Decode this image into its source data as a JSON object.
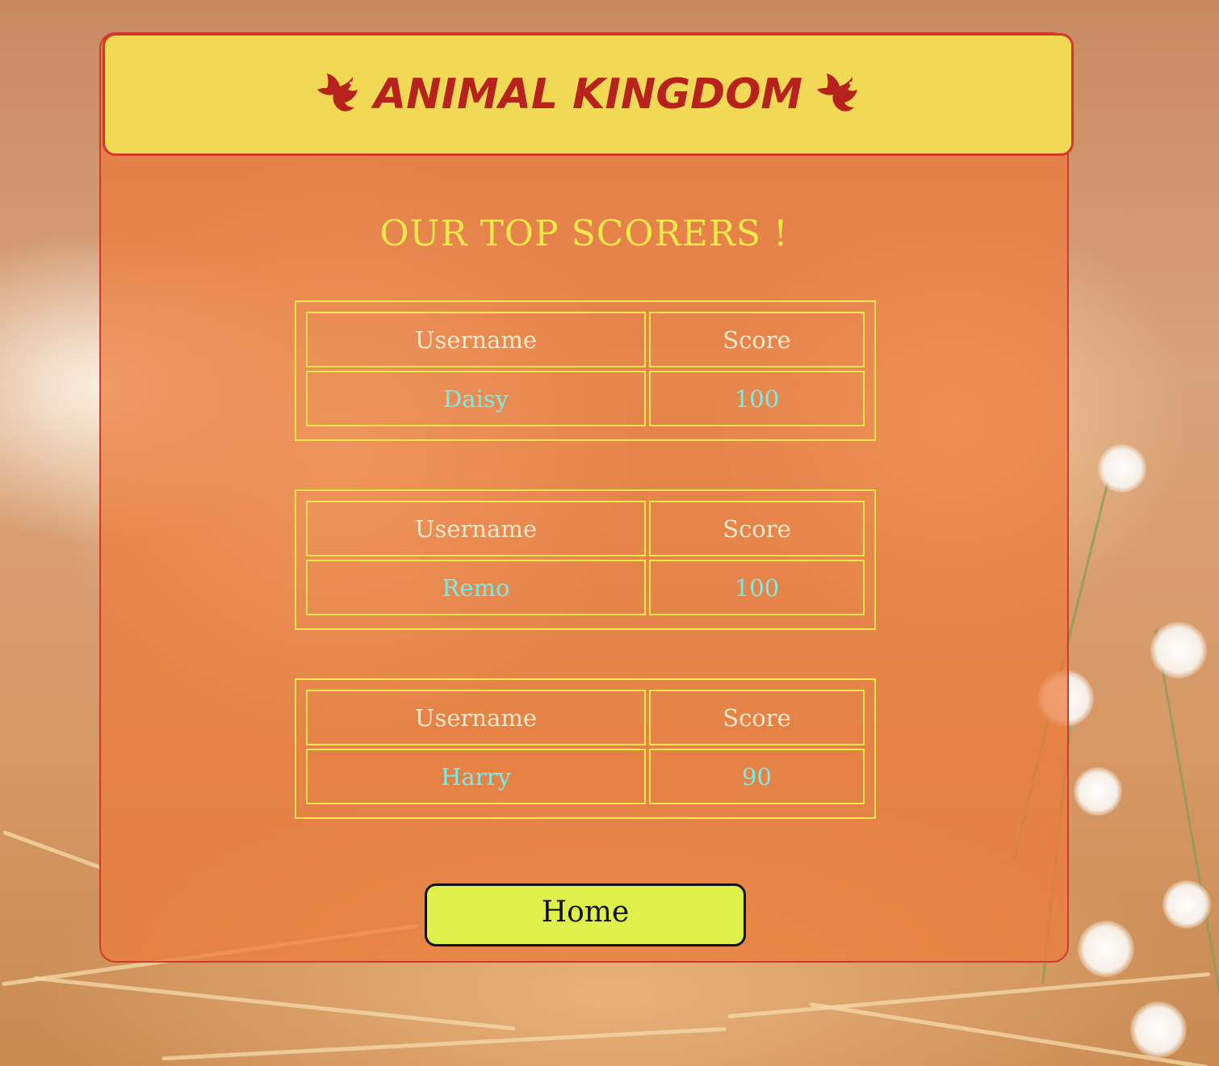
{
  "header": {
    "title": "ANIMAL KINGDOM",
    "left_icon": "dove-icon",
    "right_icon": "dove-icon"
  },
  "main": {
    "subtitle": "OUR TOP SCORERS !",
    "tables": [
      {
        "username_header": "Username",
        "score_header": "Score",
        "username": "Daisy",
        "score": "100"
      },
      {
        "username_header": "Username",
        "score_header": "Score",
        "username": "Remo",
        "score": "100"
      },
      {
        "username_header": "Username",
        "score_header": "Score",
        "username": "Harry",
        "score": "90"
      }
    ],
    "home_button": "Home"
  },
  "colors": {
    "panel_border": "#d2392b",
    "header_background": "#f2d955",
    "title": "#b8221c",
    "subtitle": "#f2e84b",
    "table_border": "#f2e84b",
    "header_cell_text": "#fbe7c9",
    "value_cell_text": "#78ece7",
    "button_background": "#dff04a"
  }
}
